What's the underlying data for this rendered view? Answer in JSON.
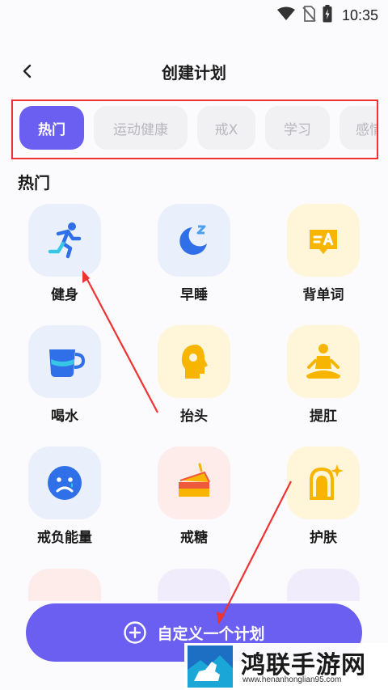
{
  "status_bar": {
    "time": "10:35",
    "icons": [
      "wifi-icon",
      "no-sim-icon",
      "battery-icon"
    ]
  },
  "header": {
    "back_icon": "chevron-left-icon",
    "title": "创建计划"
  },
  "categories": [
    {
      "label": "热门",
      "active": true
    },
    {
      "label": "运动健康",
      "active": false
    },
    {
      "label": "戒X",
      "active": false
    },
    {
      "label": "学习",
      "active": false
    },
    {
      "label": "感情建",
      "active": false
    }
  ],
  "section": {
    "title": "热门"
  },
  "items": [
    {
      "label": "健身",
      "icon": "running-person-icon"
    },
    {
      "label": "早睡",
      "icon": "moon-sleep-icon"
    },
    {
      "label": "背单词",
      "icon": "translate-card-icon"
    },
    {
      "label": "喝水",
      "icon": "water-cup-icon"
    },
    {
      "label": "抬头",
      "icon": "head-profile-icon"
    },
    {
      "label": "提肛",
      "icon": "meditation-icon"
    },
    {
      "label": "戒负能量",
      "icon": "sad-face-icon"
    },
    {
      "label": "戒糖",
      "icon": "cake-icon"
    },
    {
      "label": "护肤",
      "icon": "mirror-sparkle-icon"
    }
  ],
  "cta": {
    "icon": "plus-circle-icon",
    "label": "自定义一个计划"
  },
  "watermark": {
    "name": "鸿联手游网",
    "url": "www.henanhonglian95.com"
  },
  "colors": {
    "accent": "#6a5ff0",
    "blue_icon": "#2f6fe8",
    "yellow_icon": "#f7b500",
    "annotation_red": "#e33333"
  }
}
